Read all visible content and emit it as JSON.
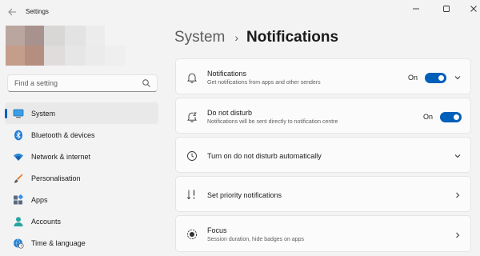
{
  "window": {
    "title": "Settings",
    "back_icon": "arrow-left-icon",
    "minimize_icon": "minimize-icon",
    "maximize_icon": "maximize-icon",
    "close_icon": "close-icon"
  },
  "search": {
    "placeholder": "Find a setting",
    "icon": "search-icon"
  },
  "sidebar": {
    "items": [
      {
        "label": "System",
        "icon": "monitor-icon",
        "active": true
      },
      {
        "label": "Bluetooth & devices",
        "icon": "bluetooth-icon",
        "active": false
      },
      {
        "label": "Network & internet",
        "icon": "wifi-icon",
        "active": false
      },
      {
        "label": "Personalisation",
        "icon": "brush-icon",
        "active": false
      },
      {
        "label": "Apps",
        "icon": "apps-icon",
        "active": false
      },
      {
        "label": "Accounts",
        "icon": "person-icon",
        "active": false
      },
      {
        "label": "Time & language",
        "icon": "globe-clock-icon",
        "active": false
      }
    ]
  },
  "header": {
    "parent": "System",
    "separator": "›",
    "current": "Notifications"
  },
  "cards": [
    {
      "title": "Notifications",
      "subtitle": "Get notifications from apps and other senders",
      "icon": "bell-icon",
      "toggle": "On",
      "toggle_on": true,
      "chevron": "chevron-down-icon"
    },
    {
      "title": "Do not disturb",
      "subtitle": "Notifications will be sent directly to notification centre",
      "icon": "bell-snooze-icon",
      "toggle": "On",
      "toggle_on": true
    },
    {
      "title": "Turn on do not disturb automatically",
      "icon": "clock-icon",
      "chevron": "chevron-down-icon"
    },
    {
      "title": "Set priority notifications",
      "icon": "priority-sort-icon",
      "chevron": "chevron-right-icon"
    },
    {
      "title": "Focus",
      "subtitle": "Session duration, hide badges on apps",
      "icon": "focus-icon",
      "chevron": "chevron-right-icon"
    }
  ],
  "colors": {
    "accent": "#005fb8",
    "background": "#f3f3f3",
    "card": "#fbfbfb"
  }
}
